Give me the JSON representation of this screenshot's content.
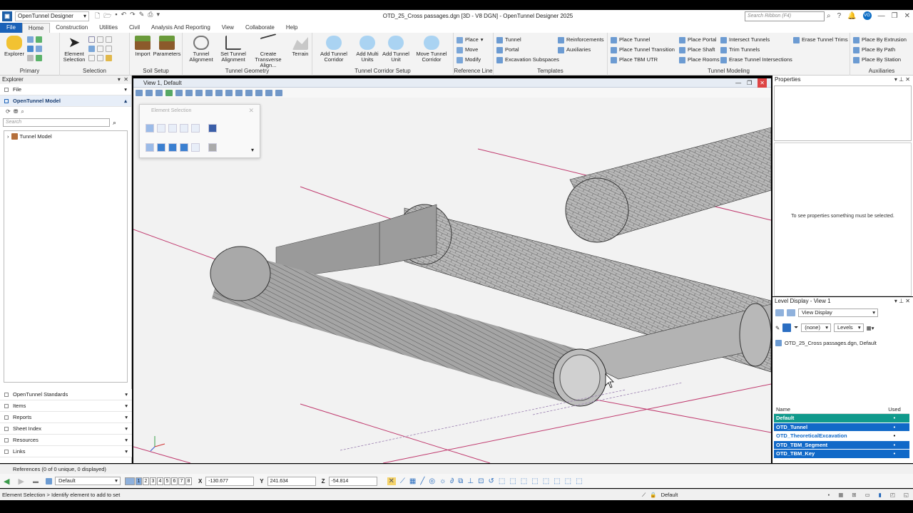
{
  "window": {
    "workspace": "OpenTunnel Designer",
    "title": "OTD_25_Cross passages.dgn [3D - V8 DGN] - OpenTunnel Designer 2025",
    "search_placeholder": "Search Ribbon (F4)",
    "avatar": "VG"
  },
  "tabs": [
    "File",
    "Home",
    "Construction",
    "Utilities",
    "Civil",
    "Analysis And Reporting",
    "View",
    "Collaborate",
    "Help"
  ],
  "active_tab": "Home",
  "ribbon": {
    "primary": {
      "label": "Primary",
      "explorer": "Explorer"
    },
    "selection": {
      "label": "Selection",
      "element_selection": "Element Selection"
    },
    "soil_setup": {
      "label": "Soil Setup",
      "import": "Import",
      "parameters": "Parameters"
    },
    "tunnel_geometry": {
      "label": "Tunnel Geometry",
      "tunnel_alignment": "Tunnel Alignment",
      "set_tunnel_alignment": "Set Tunnel Alignment",
      "create_transverse": "Create Transverse Align...",
      "terrain": "Terrain"
    },
    "corridor_setup": {
      "label": "Tunnel Corridor Setup",
      "add_tunnel_corridor": "Add Tunnel Corridor",
      "add_multi_units": "Add Multi Units",
      "add_tunnel_unit": "Add Tunnel Unit",
      "move_tunnel_corridor": "Move Tunnel Corridor"
    },
    "reference_line": {
      "label": "Reference Line",
      "place": "Place",
      "move": "Move",
      "modify": "Modify"
    },
    "templates": {
      "label": "Templates",
      "tunnel": "Tunnel",
      "portal": "Portal",
      "excavation_subspaces": "Excavation Subspaces",
      "reinforcements": "Reinforcements",
      "auxiliaries": "Auxiliaries"
    },
    "tunnel_modeling": {
      "label": "Tunnel Modeling",
      "place_tunnel": "Place Tunnel",
      "place_tunnel_transition": "Place Tunnel Transition",
      "place_tbm_utr": "Place TBM UTR",
      "place_portal": "Place Portal",
      "place_shaft": "Place Shaft",
      "place_rooms": "Place Rooms",
      "intersect_tunnels": "Intersect Tunnels",
      "trim_tunnels": "Trim Tunnels",
      "erase_tunnel_intersections": "Erase Tunnel Intersections",
      "erase_tunnel_trims": "Erase Tunnel Trims"
    },
    "auxiliaries": {
      "label": "Auxiliaries",
      "place_by_extrusion": "Place By Extrusion",
      "place_by_path": "Place By Path",
      "place_by_station": "Place By Station"
    }
  },
  "explorer": {
    "title": "Explorer",
    "file": "File",
    "model_section": "OpenTunnel Model",
    "search_placeholder": "Search",
    "tree_root": "Tunnel Model",
    "bottom_sections": [
      "OpenTunnel Standards",
      "Items",
      "Reports",
      "Sheet Index",
      "Resources",
      "Links"
    ]
  },
  "view": {
    "title": "View 1, Default"
  },
  "element_selection": {
    "title": "Element Selection"
  },
  "properties": {
    "title": "Properties",
    "empty_message": "To see properties something must be selected."
  },
  "level_display": {
    "title": "Level Display - View 1",
    "view_display": "View Display",
    "filter": "(none)",
    "levels": "Levels",
    "file_entry": "OTD_25_Cross passages.dgn, Default",
    "col_name": "Name",
    "col_used": "Used",
    "rows": [
      {
        "name": "Default",
        "used": "•"
      },
      {
        "name": "OTD_Tunnel",
        "used": "•"
      },
      {
        "name": "OTD_TheoreticalExcavation",
        "used": "•"
      },
      {
        "name": "OTD_TBM_Segment",
        "used": "•"
      },
      {
        "name": "OTD_TBM_Key",
        "used": "•"
      }
    ]
  },
  "references": "References (0 of 0 unique, 0 displayed)",
  "coordbar": {
    "view_combo": "Default",
    "view_numbers": [
      "1",
      "2",
      "3",
      "4",
      "5",
      "6",
      "7",
      "8"
    ],
    "x_label": "X",
    "x": "-130.677",
    "y_label": "Y",
    "y": "241.634",
    "z_label": "Z",
    "z": "-54.814"
  },
  "status": {
    "prompt": "Element Selection > Identify element to add to set",
    "level": "Default"
  },
  "colors": {
    "accent": "#1b62b8",
    "level_default": "#109a8c",
    "level_selected": "#1169c8",
    "tunnel_fill": "#a5a5a5",
    "axis_line": "#c03a6e"
  }
}
